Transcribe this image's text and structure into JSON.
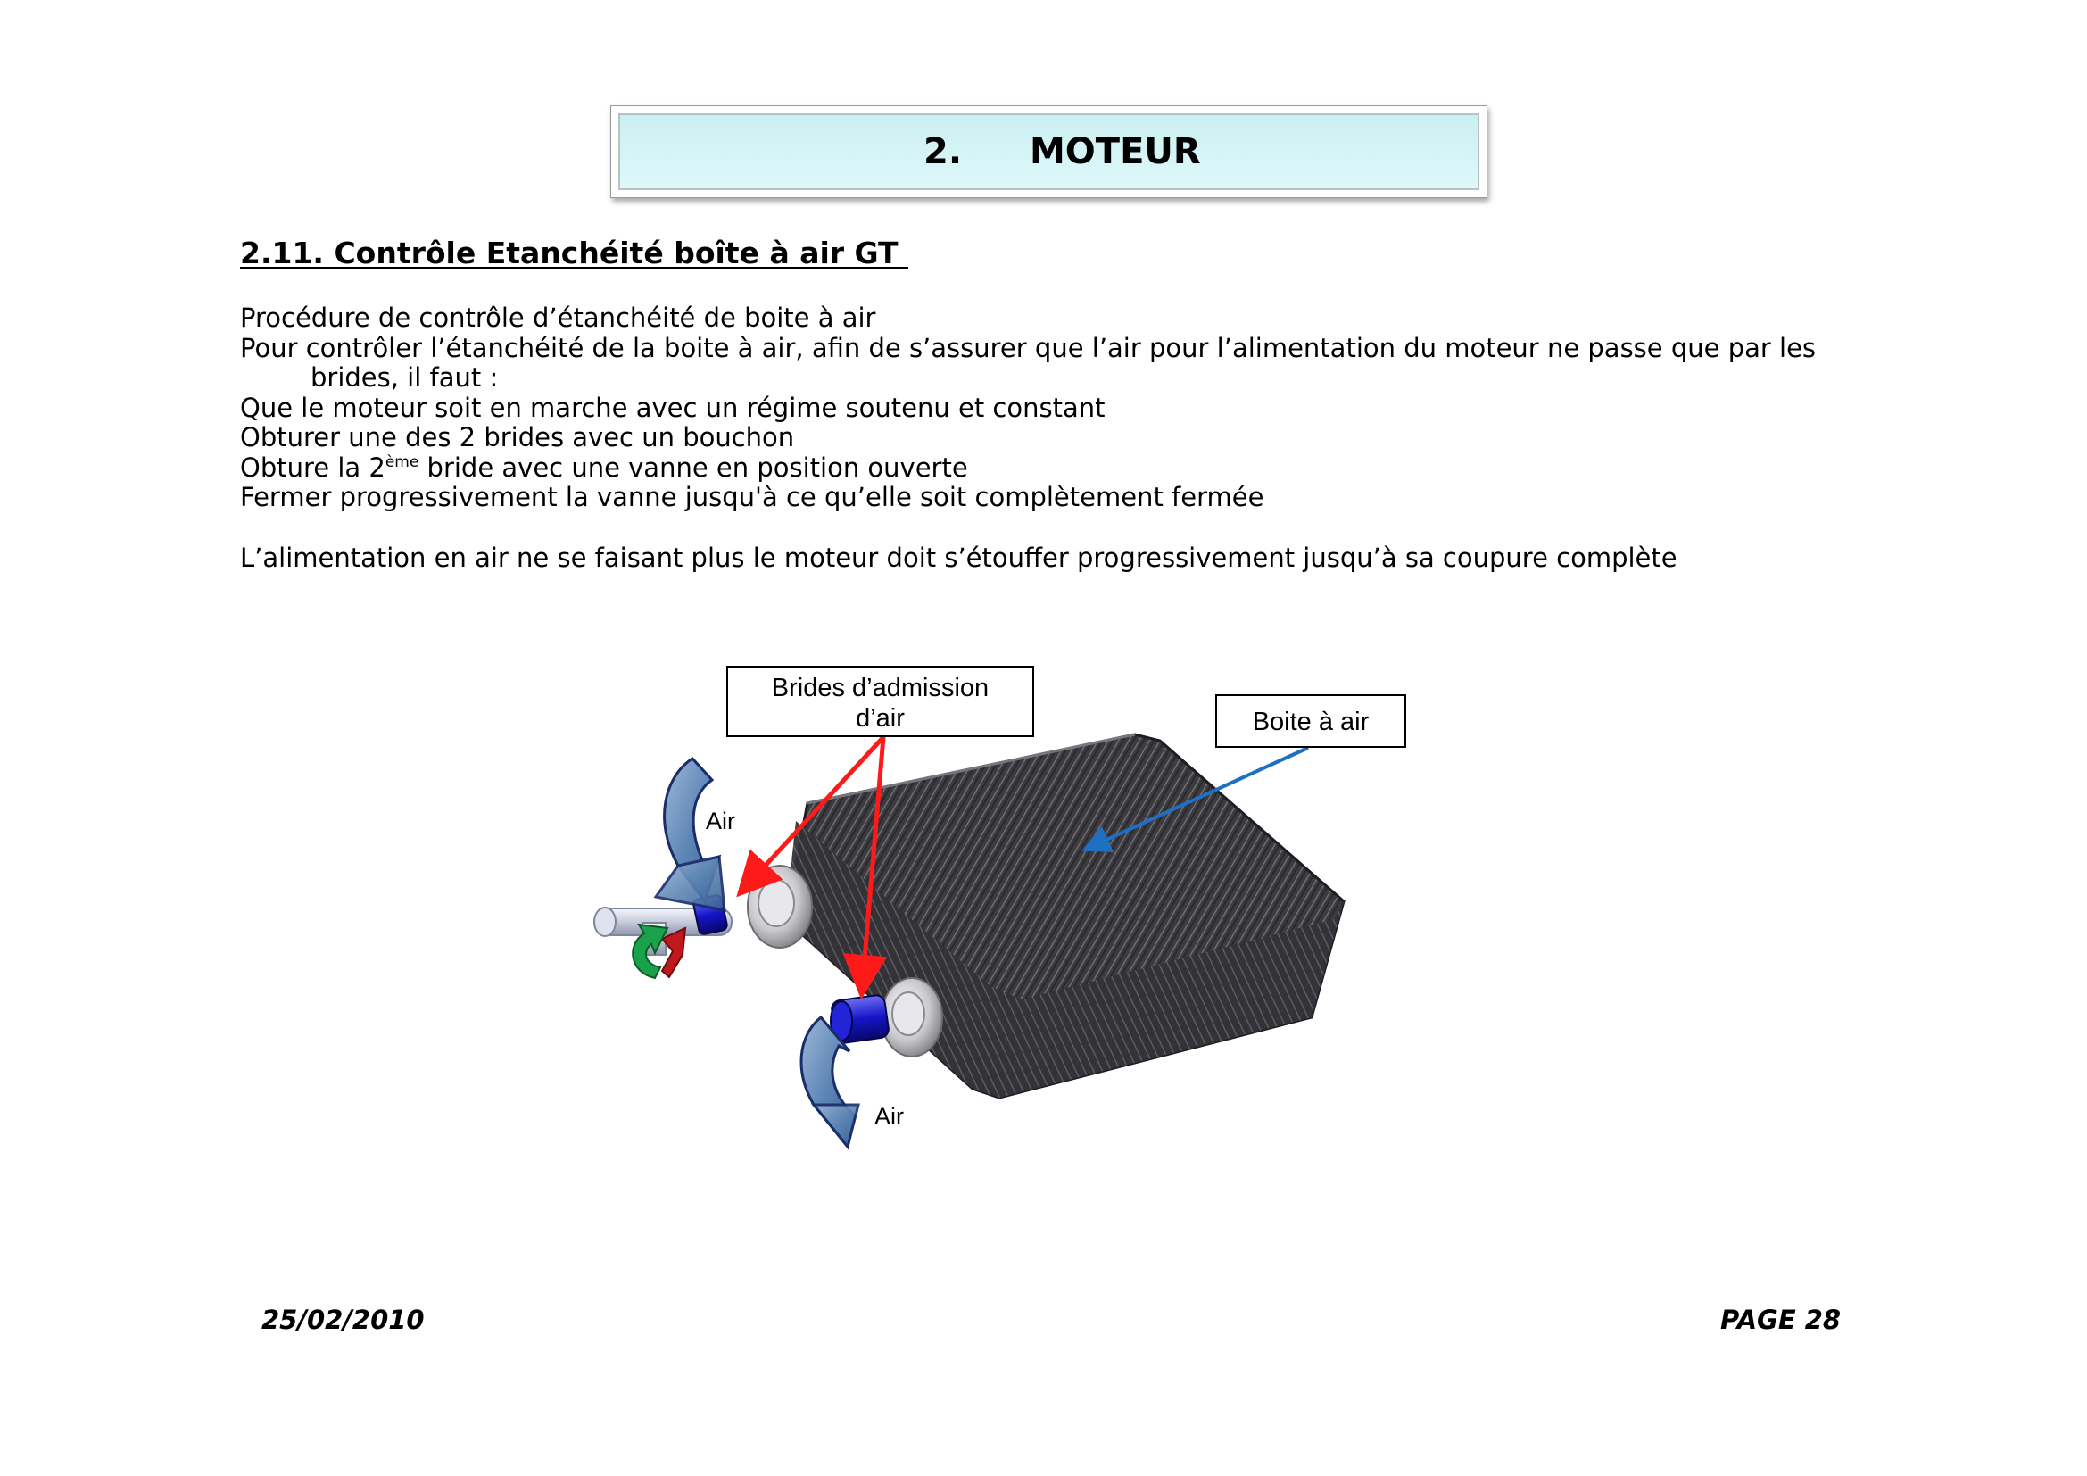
{
  "chapter": {
    "number": "2.",
    "title": "MOTEUR"
  },
  "section": {
    "heading": "2.11. Contrôle Etanchéité boîte à air GT "
  },
  "body": {
    "line1": "Procédure de contrôle d’étanchéité de boite à air",
    "line2": "Pour  contrôler l’étanchéité de la boite à air, afin de s’assurer que l’air pour l’alimentation du moteur ne passe que par les",
    "line3": "brides, il faut :",
    "line4": "Que le moteur soit en marche avec un régime soutenu et constant",
    "line5": "Obturer une des 2 brides avec un bouchon",
    "line6_pre": "Obture la 2",
    "line6_sup": "ème",
    "line6_post": " bride avec une vanne en position ouverte",
    "line7": "Fermer progressivement la vanne jusqu'à ce qu’elle soit complètement fermée",
    "line8": "L’alimentation en air ne se faisant plus le moteur doit s’étouffer progressivement jusqu’à sa coupure complète"
  },
  "diagram": {
    "callout_brides_line1": "Brides d’admission",
    "callout_brides_line2": "d’air",
    "callout_boite": "Boite à air",
    "air_label_top": "Air",
    "air_label_bottom": "Air",
    "colors": {
      "pointer_red": "#ff1a1a",
      "pointer_blue": "#1f6fc2",
      "air_arrow_fill": "#5f87b6",
      "air_arrow_stroke": "#1a2d6b",
      "box_dark": "#3c3b40",
      "flange_blue": "#1414c8",
      "valve_green": "#1aa24a",
      "valve_red": "#c0181e"
    }
  },
  "footer": {
    "date": "25/02/2010",
    "page": "PAGE 28"
  }
}
